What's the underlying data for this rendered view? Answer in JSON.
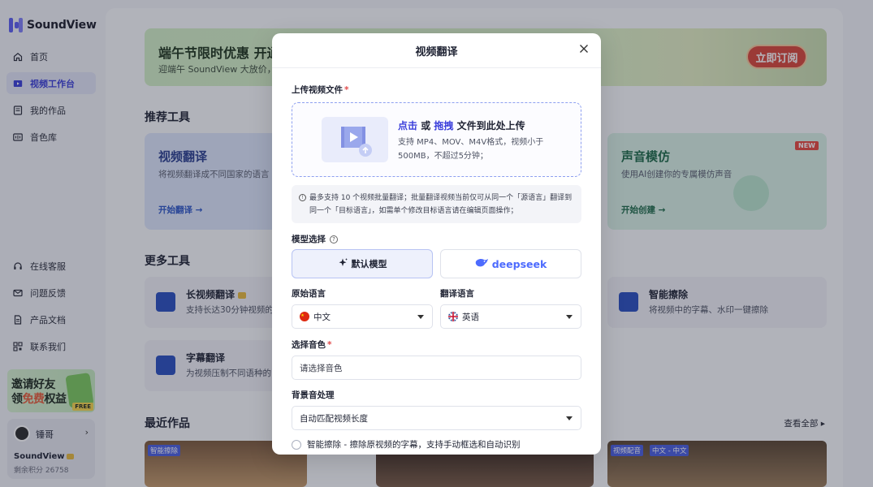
{
  "app": {
    "name": "SoundView"
  },
  "sidebar": {
    "nav": [
      {
        "label": "首页",
        "icon": "home-icon"
      },
      {
        "label": "视频工作台",
        "icon": "video-workbench-icon",
        "active": true
      },
      {
        "label": "我的作品",
        "icon": "works-icon"
      },
      {
        "label": "音色库",
        "icon": "voice-library-icon"
      }
    ],
    "support": [
      {
        "label": "在线客服",
        "icon": "headset-icon"
      },
      {
        "label": "问题反馈",
        "icon": "mail-icon"
      },
      {
        "label": "产品文档",
        "icon": "document-icon"
      },
      {
        "label": "联系我们",
        "icon": "qrcode-icon"
      }
    ],
    "invite": {
      "line1": "邀请好友",
      "line2_pre": "领",
      "line2_highlight": "免费",
      "line2_post": "权益",
      "badge": "FREE"
    },
    "user": {
      "name": "锤哥",
      "plan": "SoundView",
      "points_label": "剩余积分 26758"
    }
  },
  "main": {
    "banner": {
      "title": "端午节限时优惠 开通",
      "subtitle": "迎端午 SoundView 大放价，现",
      "button": "立即订阅"
    },
    "recommended_title": "推荐工具",
    "recommended": [
      {
        "title": "视频翻译",
        "subtitle": "将视频翻译成不同国家的语言",
        "link": "开始翻译 →"
      },
      {
        "title": "声音模仿",
        "subtitle": "使用AI创建你的专属模仿声音",
        "link": "开始创建 →",
        "badge": "NEW"
      }
    ],
    "more_title": "更多工具",
    "more": [
      {
        "title": "长视频翻译",
        "subtitle": "支持长达30分钟视频的"
      },
      {
        "title": "智能擦除",
        "subtitle": "将视频中的字幕、水印一键擦除"
      },
      {
        "title": "字幕翻译",
        "subtitle": "为视频压制不同语种的"
      }
    ],
    "recent_title": "最近作品",
    "view_all": "查看全部",
    "thumbs": [
      {
        "tags": [
          "智能擦除"
        ]
      },
      {
        "tags": []
      },
      {
        "tags": [
          "视频配音",
          "中文 - 中文"
        ]
      }
    ]
  },
  "modal": {
    "title": "视频翻译",
    "upload_label": "上传视频文件",
    "upload": {
      "click": "点击",
      "or": "或",
      "drag": "拖拽",
      "rest": "文件到此处上传",
      "desc": "支持 MP4、MOV、M4V格式，视频小于500MB，不超过5分钟；"
    },
    "notice": "最多支持 10 个视频批量翻译；批量翻译视频当前仅可从同一个「源语言」翻译到同一个「目标语言」，如需单个修改目标语言请在编辑页面操作；",
    "model_label": "模型选择",
    "model_default": "默认模型",
    "model_deepseek": "deepseek",
    "source_lang_label": "原始语言",
    "source_lang": "中文",
    "target_lang_label": "翻译语言",
    "target_lang": "英语",
    "voice_label": "选择音色",
    "voice_placeholder": "请选择音色",
    "bgm_label": "背景音处理",
    "bgm_value": "自动匹配视频长度",
    "erase_option": "智能擦除 - 擦除原视频的字幕，支持手动框选和自动识别"
  }
}
